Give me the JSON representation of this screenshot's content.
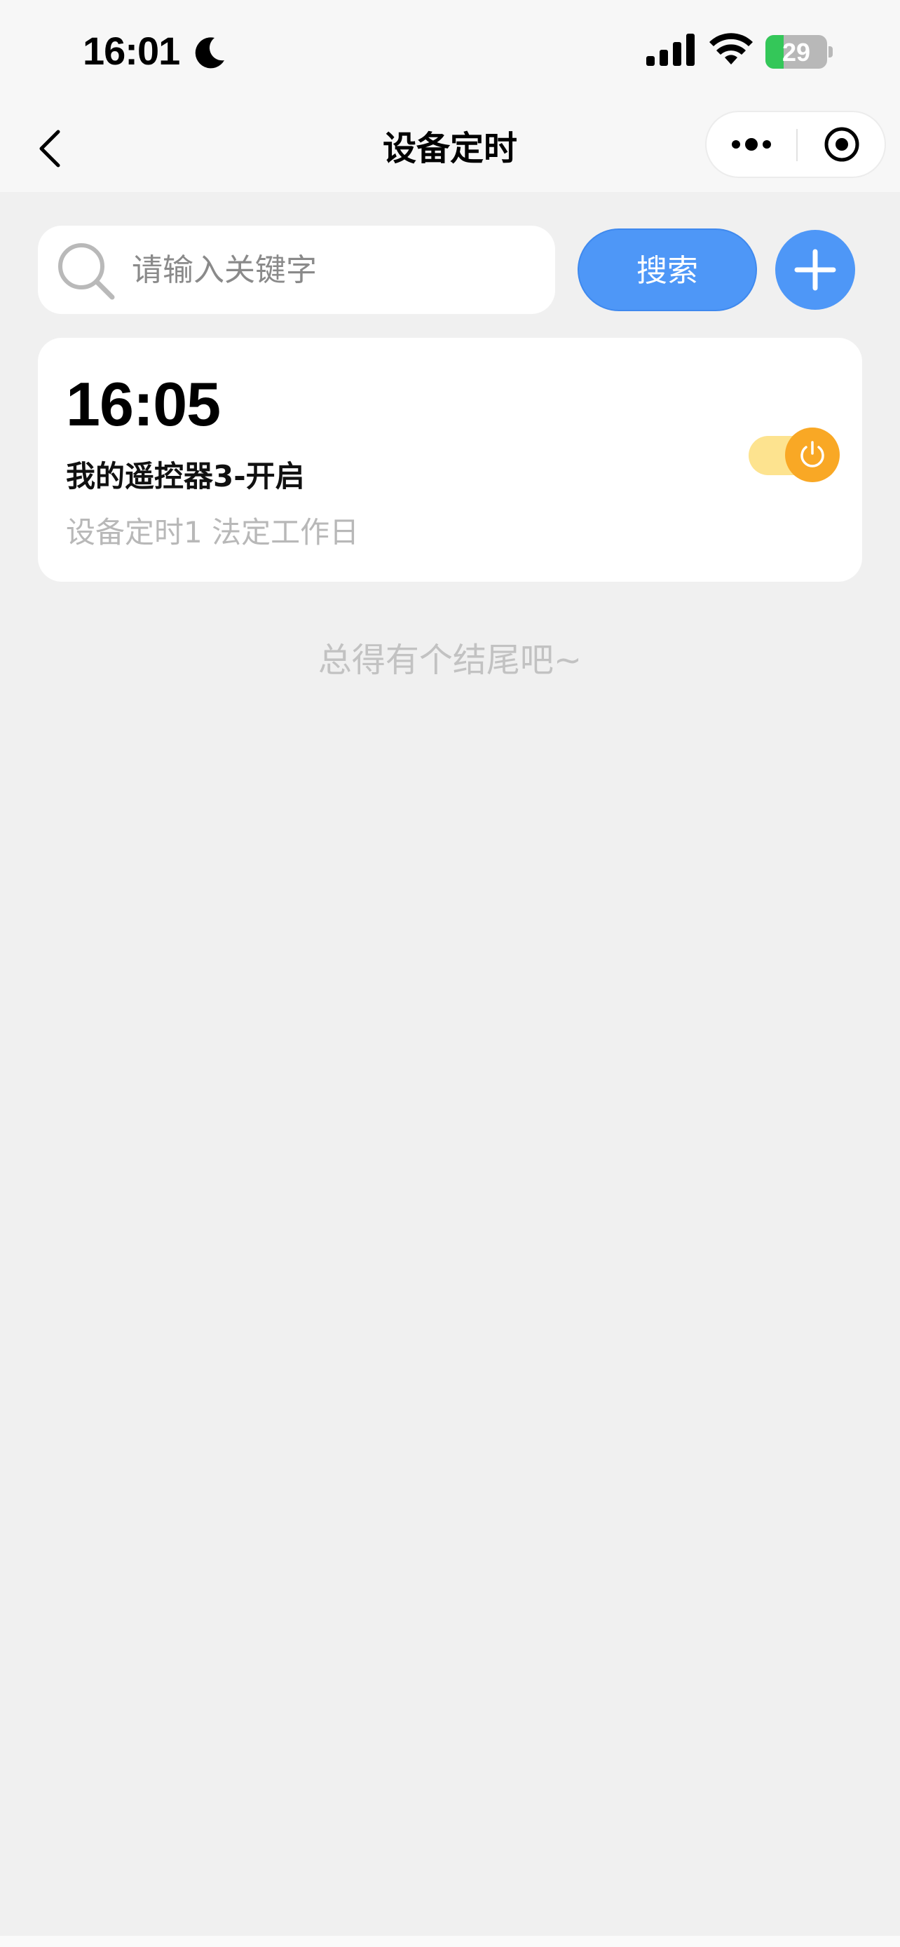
{
  "status_bar": {
    "time": "16:01",
    "battery_level": "29",
    "battery_fraction": 0.29,
    "icons": [
      "moon-icon",
      "signal-icon",
      "wifi-icon",
      "battery-charging-icon"
    ]
  },
  "nav": {
    "title": "设备定时",
    "back_icon": "chevron-left-icon",
    "more_icon": "more-dots-icon",
    "close_icon": "target-close-icon"
  },
  "search": {
    "placeholder": "请输入关键字",
    "value": "",
    "button_label": "搜索",
    "add_icon": "plus-icon"
  },
  "timers": [
    {
      "time": "16:05",
      "title": "我的遥控器3-开启",
      "subtitle": "设备定时1 法定工作日",
      "enabled": true
    }
  ],
  "footer_note": "总得有个结尾吧~",
  "colors": {
    "accent": "#4e97f7",
    "toggle_on": "#f9a825",
    "toggle_track": "#fde38f",
    "background": "#f0f0f0",
    "battery_green": "#34c759"
  }
}
